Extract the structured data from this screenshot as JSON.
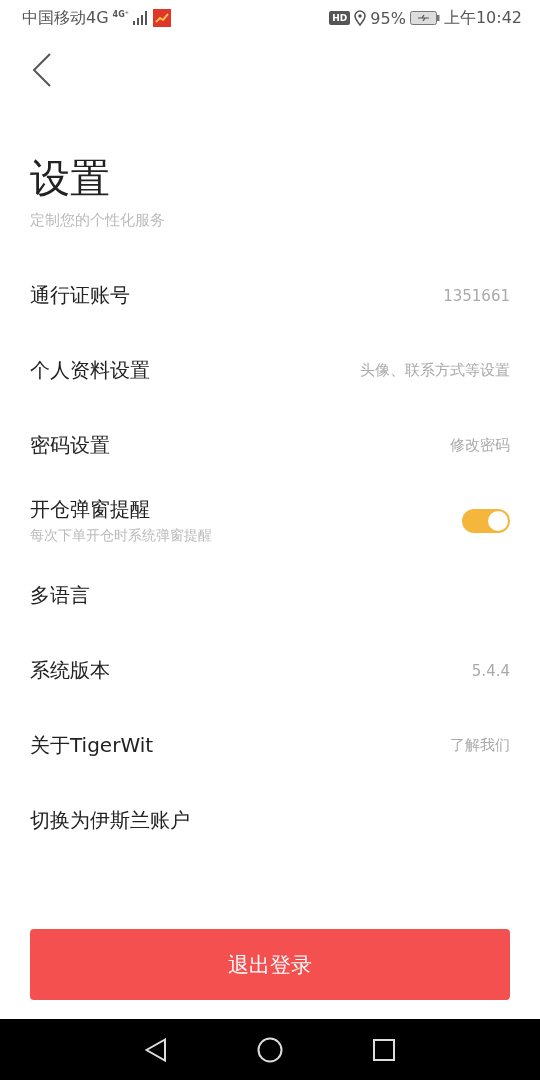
{
  "status_bar": {
    "carrier": "中国移动4G",
    "network": "4G⁺",
    "hd": "HD",
    "battery": "95%",
    "time": "上午10:42"
  },
  "header": {
    "title": "设置",
    "subtitle": "定制您的个性化服务"
  },
  "rows": [
    {
      "kind": "value",
      "label": "通行证账号",
      "value": "1351661"
    },
    {
      "kind": "value",
      "label": "个人资料设置",
      "value": "头像、联系方式等设置"
    },
    {
      "kind": "value",
      "label": "密码设置",
      "value": "修改密码"
    },
    {
      "kind": "toggle",
      "label": "开仓弹窗提醒",
      "note": "每次下单开仓时系统弹窗提醒",
      "on": true
    },
    {
      "kind": "value",
      "label": "多语言"
    },
    {
      "kind": "value",
      "label": "系统版本",
      "value": "5.4.4"
    },
    {
      "kind": "value",
      "label": "关于TigerWit",
      "value": "了解我们"
    },
    {
      "kind": "value",
      "label": "切换为伊斯兰账户"
    }
  ],
  "logout_button": "退出登录"
}
